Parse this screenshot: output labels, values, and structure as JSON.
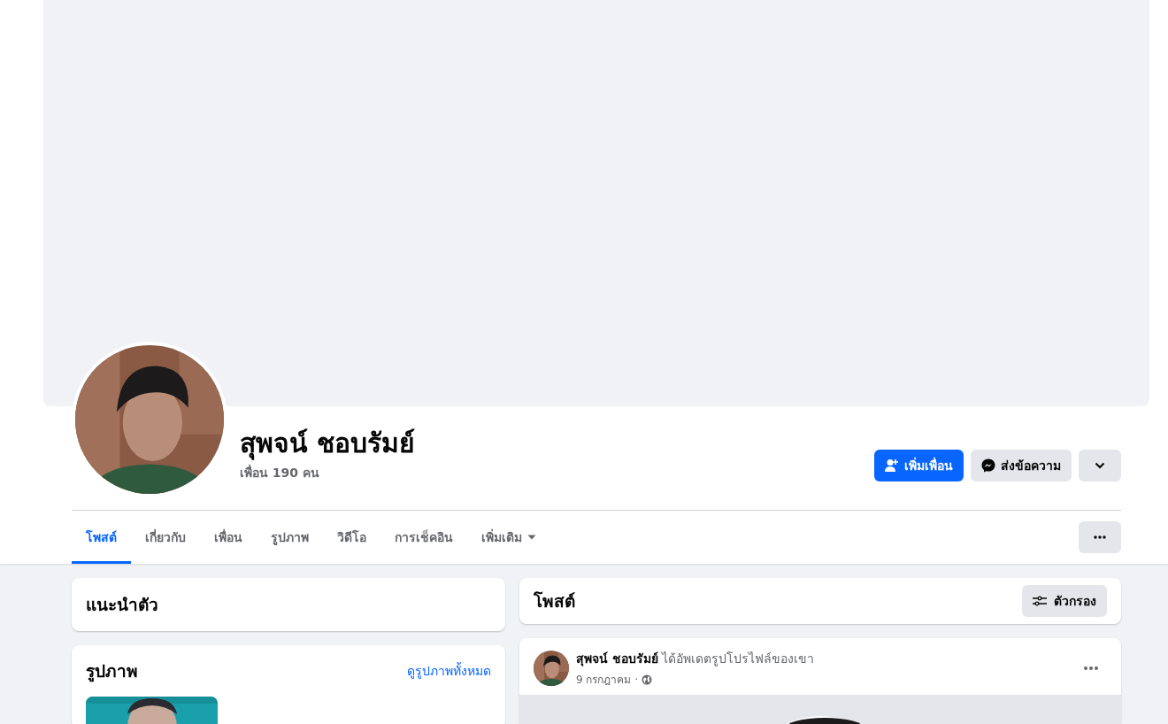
{
  "profile": {
    "name": "สุพจน์ ชอบรัมย์",
    "friends": "เพื่อน 190 คน"
  },
  "actions": [
    {
      "kind": "primary",
      "label": "เพิ่มเพื่อน"
    },
    {
      "kind": "secondary",
      "label": "ส่งข้อความ"
    },
    {
      "kind": "menu"
    }
  ],
  "tabs": [
    {
      "label": "โพสต์",
      "selected": true,
      "kind": "link"
    },
    {
      "label": "เกี่ยวกับ",
      "selected": false,
      "kind": "link"
    },
    {
      "label": "เพื่อน",
      "selected": false,
      "kind": "link"
    },
    {
      "label": "รูปภาพ",
      "selected": false,
      "kind": "link"
    },
    {
      "label": "วิดีโอ",
      "selected": false,
      "kind": "link"
    },
    {
      "label": "การเช็คอิน",
      "selected": false,
      "kind": "link"
    },
    {
      "label": "เพิ่มเติม",
      "selected": false,
      "kind": "dropdown"
    }
  ],
  "intro": {
    "title": "แนะนำตัว"
  },
  "photos": {
    "title": "รูปภาพ",
    "link": "ดูรูปภาพทั้งหมด"
  },
  "posts_header": {
    "title": "โพสต์",
    "filter_button": "ตัวกรอง"
  },
  "post": {
    "headline": "**สุพจน์ ชอบรัมย์** ได้อัพเดตรูปโปรไฟล์ของเขา",
    "date": "9 กรกฎาคม ·"
  }
}
